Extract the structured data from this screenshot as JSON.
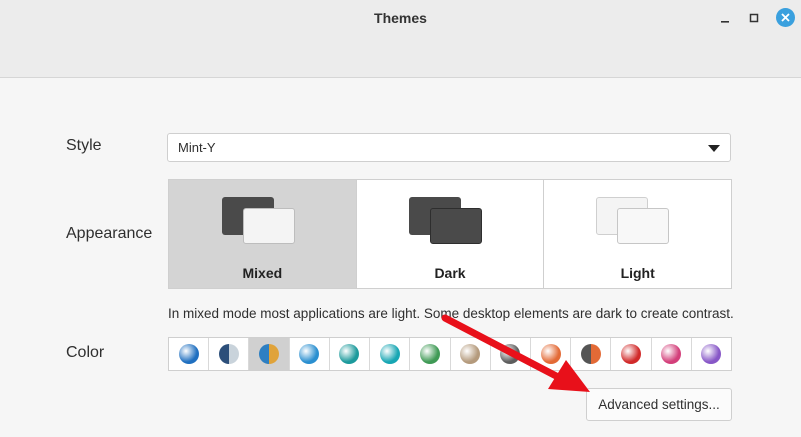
{
  "window": {
    "title": "Themes"
  },
  "style": {
    "label": "Style",
    "value": "Mint-Y"
  },
  "appearance": {
    "label": "Appearance",
    "options": [
      {
        "name": "Mixed",
        "selected": true
      },
      {
        "name": "Dark",
        "selected": false
      },
      {
        "name": "Light",
        "selected": false
      }
    ],
    "description": "In mixed mode most applications are light. Some desktop elements are dark to create contrast."
  },
  "color": {
    "label": "Color",
    "swatches": [
      {
        "id": "blue",
        "colors": [
          "#1f6fc0"
        ]
      },
      {
        "id": "aqua-grey",
        "colors": [
          "#2c4f7a",
          "#c9d3db"
        ]
      },
      {
        "id": "orange-blue",
        "colors": [
          "#2d7fc2",
          "#e0a33a"
        ],
        "selected": true
      },
      {
        "id": "light-blue",
        "colors": [
          "#2a8fd0"
        ]
      },
      {
        "id": "teal",
        "colors": [
          "#1c9a9c"
        ]
      },
      {
        "id": "cyan",
        "colors": [
          "#17a6b3"
        ]
      },
      {
        "id": "green",
        "colors": [
          "#3f9a55"
        ]
      },
      {
        "id": "sand",
        "colors": [
          "#b49a7c"
        ]
      },
      {
        "id": "grey",
        "colors": [
          "#5d5d5d"
        ]
      },
      {
        "id": "orange",
        "colors": [
          "#e36a36"
        ]
      },
      {
        "id": "orange-dark",
        "colors": [
          "#555555",
          "#e36a36"
        ]
      },
      {
        "id": "red",
        "colors": [
          "#d12a2a"
        ]
      },
      {
        "id": "pink",
        "colors": [
          "#d33f7a"
        ]
      },
      {
        "id": "purple",
        "colors": [
          "#8757c7"
        ]
      }
    ]
  },
  "buttons": {
    "advanced": "Advanced settings..."
  },
  "annotation": {
    "arrow_color": "#e8101a"
  }
}
